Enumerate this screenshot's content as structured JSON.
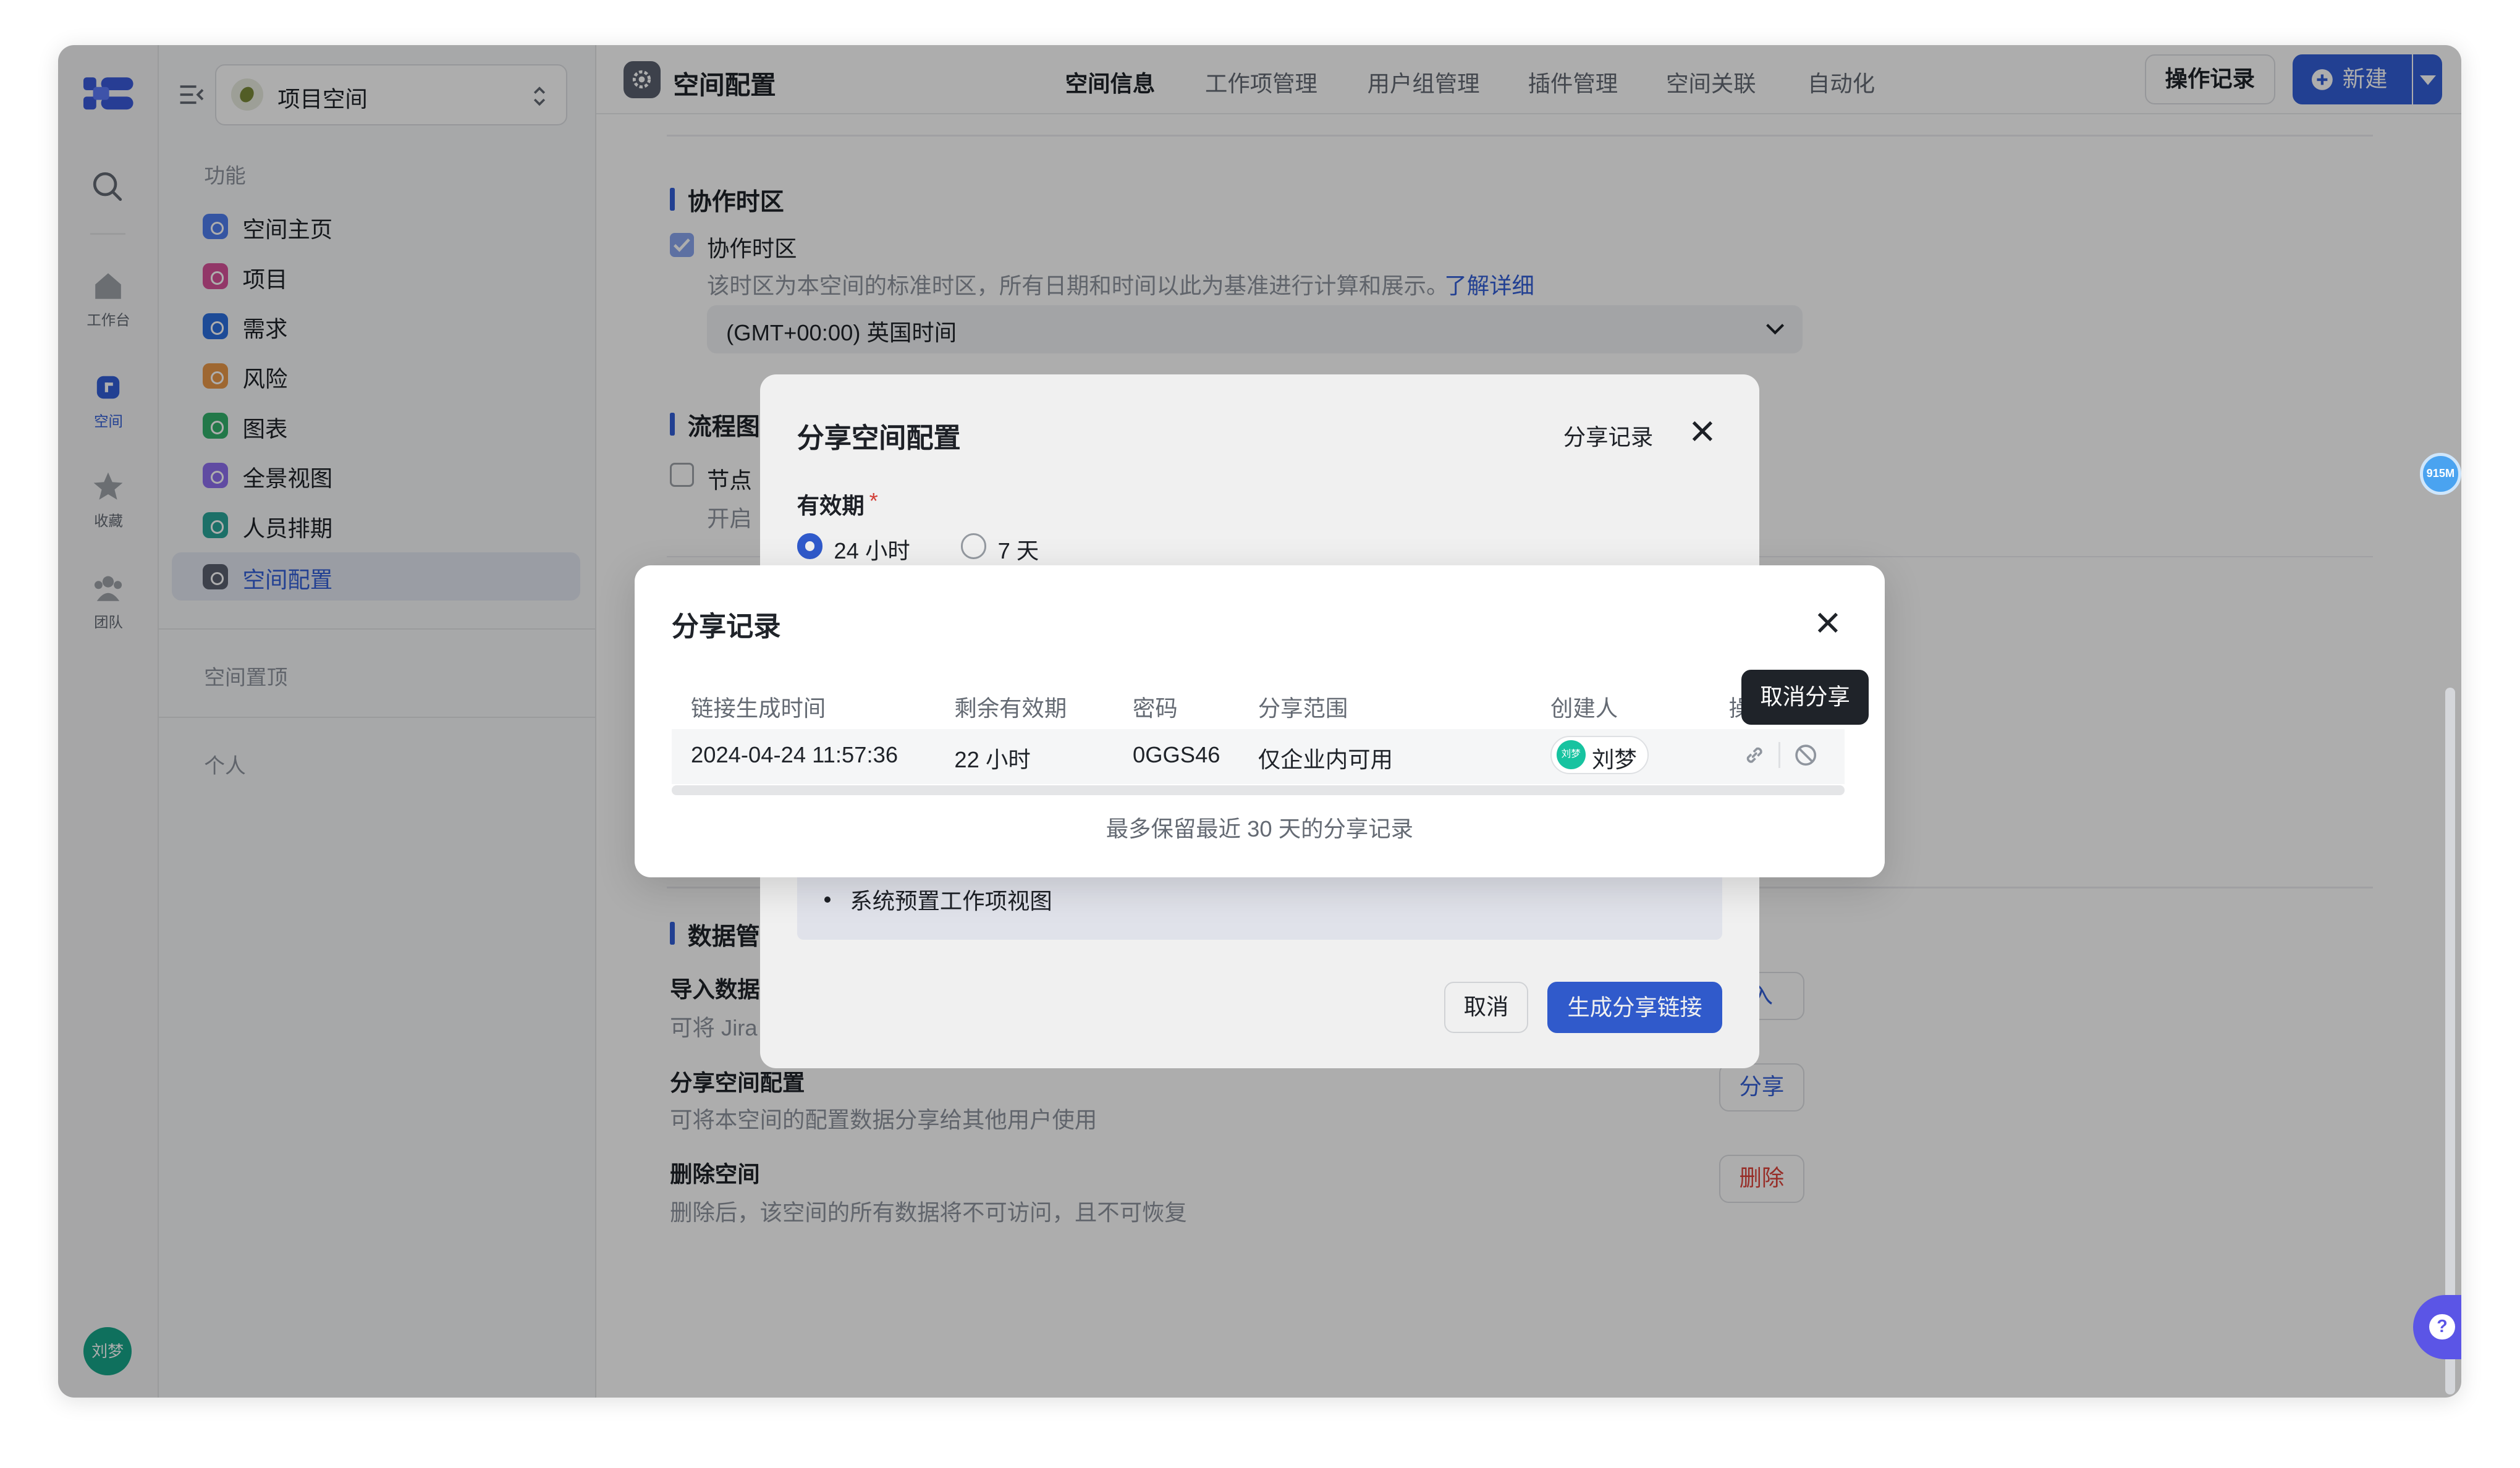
{
  "rail": {
    "items": [
      {
        "label": "工作台",
        "icon": "home-icon"
      },
      {
        "label": "空间",
        "icon": "space-icon"
      },
      {
        "label": "收藏",
        "icon": "star-icon"
      },
      {
        "label": "团队",
        "icon": "team-icon"
      }
    ],
    "avatar": "刘梦"
  },
  "sidebar": {
    "space_selector": "项目空间",
    "section_function": "功能",
    "items": [
      {
        "label": "空间主页",
        "color": "#4f7ef0"
      },
      {
        "label": "项目",
        "color": "#d8539a"
      },
      {
        "label": "需求",
        "color": "#2b6fe0"
      },
      {
        "label": "风险",
        "color": "#e9994a"
      },
      {
        "label": "图表",
        "color": "#34b26c"
      },
      {
        "label": "全景视图",
        "color": "#8e6ff0"
      },
      {
        "label": "人员排期",
        "color": "#2aa59a"
      },
      {
        "label": "空间配置",
        "color": "#5b6270"
      }
    ],
    "section_pinned": "空间置顶",
    "section_personal": "个人"
  },
  "header": {
    "title": "空间配置",
    "tabs": [
      "空间信息",
      "工作项管理",
      "用户组管理",
      "插件管理",
      "空间关联",
      "自动化"
    ],
    "active_tab": "空间信息",
    "history_button": "操作记录",
    "new_button": "新建"
  },
  "main": {
    "timezone": {
      "heading": "协作时区",
      "checkbox_label": "协作时区",
      "description": "该时区为本空间的标准时区，所有日期和时间以此为基准进行计算和展示。",
      "learn_more": "了解详细",
      "selected": "(GMT+00:00) 英国时间"
    },
    "flow": {
      "heading": "流程图",
      "checkbox_label": "节点",
      "description": "开启"
    },
    "data": {
      "heading": "数据管",
      "import_title": "导入数据",
      "import_desc": "可将 Jira",
      "import_button": "入",
      "share_title": "分享空间配置",
      "share_desc": "可将本空间的配置数据分享给其他用户使用",
      "share_button": "分享",
      "delete_title": "删除空间",
      "delete_desc": "删除后，该空间的所有数据将不可访问，且不可恢复",
      "delete_button": "删除"
    }
  },
  "share_dialog": {
    "title": "分享空间配置",
    "records_link": "分享记录",
    "validity_label": "有效期",
    "required_mark": "*",
    "options": [
      "24 小时",
      "7 天"
    ],
    "selected_option": "24 小时",
    "bullet_item": "系统预置工作项视图",
    "cancel": "取消",
    "generate": "生成分享链接"
  },
  "records_dialog": {
    "title": "分享记录",
    "columns": [
      "链接生成时间",
      "剩余有效期",
      "密码",
      "分享范围",
      "创建人",
      "操"
    ],
    "rows": [
      {
        "created": "2024-04-24 11:57:36",
        "remaining": "22 小时",
        "password": "0GGS46",
        "scope": "仅企业内可用",
        "creator": "刘梦",
        "creator_avatar": "刘梦"
      }
    ],
    "footer": "最多保留最近 30 天的分享记录",
    "tooltip": "取消分享"
  },
  "floating": {
    "memory_badge": "915M",
    "help_icon": "?"
  }
}
